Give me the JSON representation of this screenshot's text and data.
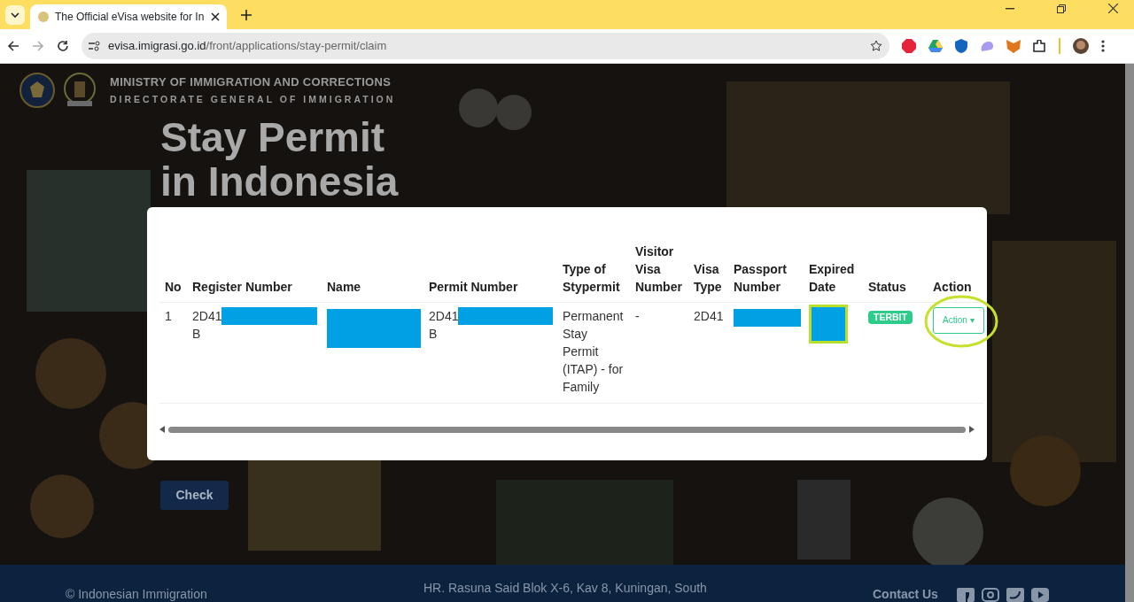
{
  "browser": {
    "tab_title": "The Official eVisa website for In",
    "url_host": "evisa.imigrasi.go.id",
    "url_path": "/front/applications/stay-permit/claim"
  },
  "header": {
    "ministry": "MINISTRY OF IMMIGRATION AND CORRECTIONS",
    "directorate": "DIRECTORATE GENERAL OF IMMIGRATION"
  },
  "hero": {
    "title_lines": [
      "Stay Permit",
      "in Indonesia"
    ]
  },
  "table": {
    "columns": [
      "No",
      "Register Number",
      "Name",
      "Permit Number",
      "Type of Stypermit",
      "Visitor Visa Number",
      "Visa Type",
      "Passport Number",
      "Expired Date",
      "Status",
      "Action"
    ],
    "rows": [
      {
        "cells": [
          {
            "kind": "text",
            "text": "1"
          },
          {
            "kind": "text",
            "text": "2D41",
            "line2": "B",
            "redacted": true
          },
          {
            "kind": "text",
            "redacted": true,
            "highlighted": false
          },
          {
            "kind": "text",
            "text": "2D41",
            "line2": "B",
            "redacted": true
          },
          {
            "kind": "text",
            "text": "Permanent Stay Permit (ITAP) - for Family"
          },
          {
            "kind": "text",
            "text": "-"
          },
          {
            "kind": "text",
            "text": "2D41"
          },
          {
            "kind": "text",
            "redacted": true,
            "highlighted": false
          },
          {
            "kind": "text",
            "redacted": true,
            "highlighted": true
          },
          {
            "kind": "badge",
            "text": "TERBIT",
            "color": "#2ecc8a"
          },
          {
            "kind": "dropdown",
            "text": "Action",
            "caret": "▾",
            "circled": true
          }
        ]
      }
    ]
  },
  "check_button": "Check",
  "footer": {
    "copyright": "© Indonesian Immigration",
    "address": "HR. Rasuna Said Blok X-6, Kav 8, Kuningan, South",
    "contact": "Contact Us"
  }
}
